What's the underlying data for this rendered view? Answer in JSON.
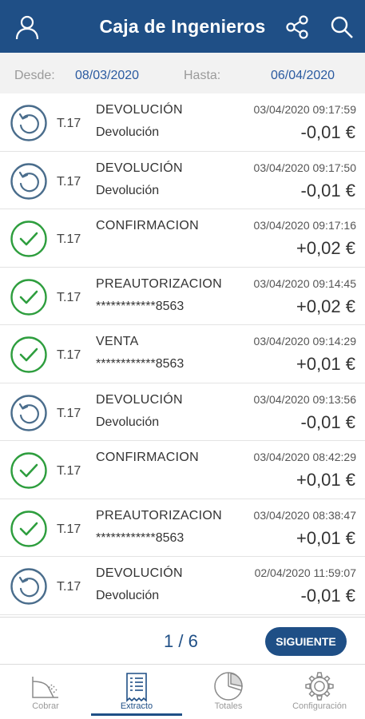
{
  "header": {
    "title": "Caja de Ingenieros",
    "icons": [
      "user-icon",
      "share-icon",
      "search-icon"
    ]
  },
  "filter": {
    "from_label": "Desde:",
    "from_value": "08/03/2020",
    "to_label": "Hasta:",
    "to_value": "06/04/2020"
  },
  "transactions": [
    {
      "status": "refund",
      "terminal": "T.17",
      "type": "DEVOLUCIÓN",
      "detail": "Devolución",
      "date": "03/04/2020 09:17:59",
      "amount": "-0,01 €"
    },
    {
      "status": "refund",
      "terminal": "T.17",
      "type": "DEVOLUCIÓN",
      "detail": "Devolución",
      "date": "03/04/2020 09:17:50",
      "amount": "-0,01 €"
    },
    {
      "status": "ok",
      "terminal": "T.17",
      "type": "CONFIRMACION",
      "detail": "",
      "date": "03/04/2020 09:17:16",
      "amount": "+0,02 €"
    },
    {
      "status": "ok",
      "terminal": "T.17",
      "type": "PREAUTORIZACION",
      "detail": "************8563",
      "date": "03/04/2020 09:14:45",
      "amount": "+0,02 €"
    },
    {
      "status": "ok",
      "terminal": "T.17",
      "type": "VENTA",
      "detail": "************8563",
      "date": "03/04/2020 09:14:29",
      "amount": "+0,01 €"
    },
    {
      "status": "refund",
      "terminal": "T.17",
      "type": "DEVOLUCIÓN",
      "detail": "Devolución",
      "date": "03/04/2020 09:13:56",
      "amount": "-0,01 €"
    },
    {
      "status": "ok",
      "terminal": "T.17",
      "type": "CONFIRMACION",
      "detail": "",
      "date": "03/04/2020 08:42:29",
      "amount": "+0,01 €"
    },
    {
      "status": "ok",
      "terminal": "T.17",
      "type": "PREAUTORIZACION",
      "detail": "************8563",
      "date": "03/04/2020 08:38:47",
      "amount": "+0,01 €"
    },
    {
      "status": "refund",
      "terminal": "T.17",
      "type": "DEVOLUCIÓN",
      "detail": "Devolución",
      "date": "02/04/2020 11:59:07",
      "amount": "-0,01 €"
    }
  ],
  "pagination": {
    "page": "1 / 6",
    "next_label": "SIGUIENTE"
  },
  "nav": {
    "tabs": [
      {
        "label": "Cobrar",
        "icon": "receipt-cut-icon",
        "active": false
      },
      {
        "label": "Extracto",
        "icon": "statement-icon",
        "active": true
      },
      {
        "label": "Totales",
        "icon": "pie-chart-icon",
        "active": false
      },
      {
        "label": "Configuración",
        "icon": "gear-icon",
        "active": false
      }
    ]
  },
  "colors": {
    "primary": "#1f4f86",
    "ok": "#2e9e3e",
    "refund": "#4a6d8c"
  }
}
